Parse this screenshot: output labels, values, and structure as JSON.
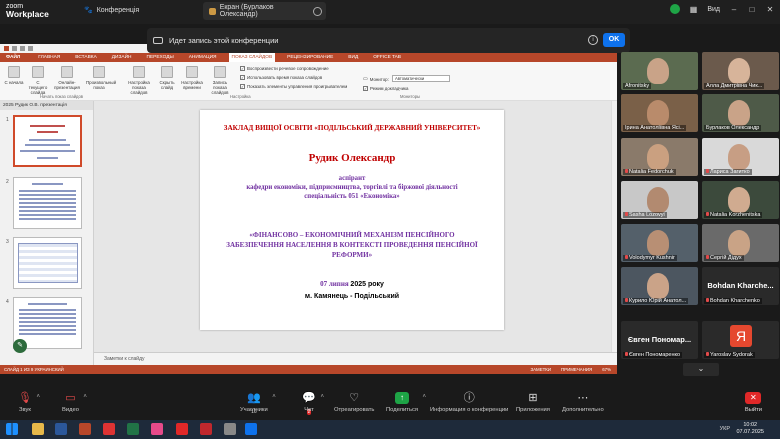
{
  "zoom": {
    "logo_top": "zoom",
    "logo_bottom": "Workplace",
    "conference_tab": "Конференція",
    "screen_tab": "Екран (Бурлаков Олександр)",
    "view_label": "Вид",
    "recording_notice": "Идет запись этой конференции",
    "ok_button": "OK"
  },
  "ppt": {
    "tabs": [
      "ФАЙЛ",
      "ГЛАВНАЯ",
      "ВСТАВКА",
      "ДИЗАЙН",
      "ПЕРЕХОДЫ",
      "АНИМАЦИЯ",
      "ПОКАЗ СЛАЙДОВ",
      "РЕЦЕНЗИРОВАНИЕ",
      "ВИД",
      "OFFICE TAB"
    ],
    "active_tab_index": 6,
    "ribbon_buttons": [
      "С начала",
      "С текущего слайда",
      "Онлайн-презентация",
      "Произвольный показ",
      "Настройка показа слайдов",
      "Скрыть слайд",
      "Настройка времени",
      "Запись показа слайдов"
    ],
    "ribbon_checks": [
      "Воспроизвести речевое сопровождение",
      "Использовать время показа слайдов",
      "Показать элементы управления проигрывателем"
    ],
    "monitor_label": "Монитор:",
    "monitor_value": "Автоматически",
    "presenter_mode": "Режим докладчика",
    "group_start": "Начать показ слайдов",
    "group_setup": "Настройка",
    "group_monitors": "Мониторы",
    "doc_tab": "2025 Рудик О.В. презентація",
    "thumb_numbers": [
      "1",
      "2",
      "3",
      "4"
    ],
    "slide": {
      "institution": "ЗАКЛАД ВИЩОЇ ОСВІТИ «ПОДІЛЬСЬКИЙ ДЕРЖАВНИЙ УНІВЕРСИТЕТ»",
      "name": "Рудик Олександр",
      "role_1": "аспірант",
      "role_2": "кафедри економіки, підприємництва, торгівлі та біржової діяльності",
      "role_3": "спеціальність 051 «Економіка»",
      "thesis_title": "«ФІНАНСОВО – ЕКОНОМІЧНИЙ МЕХАНІЗМ ПЕНСІЙНОГО ЗАБЕЗПЕЧЕННЯ НАСЕЛЕННЯ В КОНТЕКСТІ ПРОВЕДЕННЯ ПЕНСІЙНОЇ РЕФОРМИ»",
      "date_day": "07 липня",
      "date_year": "2025 року",
      "place": "м. Камянець - Подільський"
    },
    "notes_placeholder": "Заметки к слайду",
    "status_left": "СЛАЙД 1 ИЗ 9   УКРАИНСКИЙ",
    "status_notes": "ЗАМЕТКИ",
    "status_comments": "ПРИМЕЧАНИЯ",
    "status_zoom": "67%"
  },
  "participants": [
    "Afronitsky",
    "Алла Дмитрівна Чик...",
    "Ірина Анатоліївна Ясі...",
    "Бурлаков Олександр",
    "Natalia Fedorchuk",
    "Лариса Загитко",
    "Sasha Lozovyi",
    "Natalia Korzhenitska",
    "Volodymyr Kushnir",
    "Сергій Дідух",
    "Курило Юрій Анатол...",
    "Bohdan Kharchenko",
    "Євген Пономаренко",
    "Yaroslav Sydorak"
  ],
  "text_tiles": {
    "bohdan_big": "Bohdan Kharche...",
    "yevhen_big": "Євген Пономар...",
    "yaroslav_initial": "Я"
  },
  "toolbar": {
    "audio": "Звук",
    "video": "Видео",
    "participants": "Участники",
    "participants_count": "16",
    "chat": "Чат",
    "chat_badge": "2",
    "moderated": "Отреагировать",
    "share": "Поделиться",
    "info": "Информация о конференции",
    "apps": "Приложения",
    "more": "Дополнительно",
    "leave": "Выйти"
  },
  "taskbar": {
    "lang": "УКР",
    "time": "10:02",
    "date": "07.07.2025"
  },
  "colors": {
    "ppt_accent": "#b7472a",
    "zoom_blue": "#0e72ed",
    "slide_red": "#c00000",
    "slide_purple": "#7030a0",
    "leave_red": "#e02828"
  }
}
